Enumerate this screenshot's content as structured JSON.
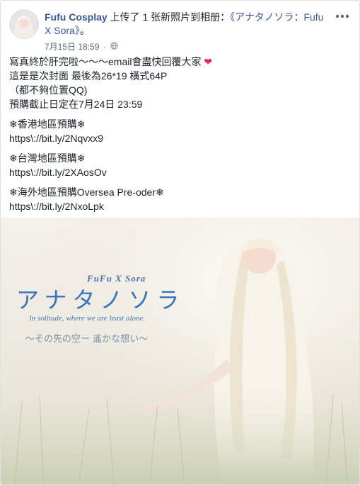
{
  "post": {
    "author": "Fufu Cosplay",
    "action": " 上传了 1 张新照片到相册：",
    "album": "《アナタノソラ：Fufu X Sora》",
    "album_suffix": "。",
    "timestamp": "7月15日 18:59",
    "privacy_icon": "globe-icon",
    "more_icon": "more-options-icon",
    "heart_icon": "red-heart-emoji"
  },
  "body": {
    "lines": [
      "寫真終於肝完啦～～～email會盡快回覆大家",
      "這是是次封面 最後為26*19 橫式64P",
      "（都不夠位置QQ)",
      "預購截止日定在7月24日 23:59"
    ],
    "hk_title": "❄香港地區預購❄",
    "hk_link": "https\\://bit.ly/2Nqvxx9",
    "tw_title": "❄台灣地區預購❄",
    "tw_link": "https\\://bit.ly/2XAosOv",
    "os_title": "❄海外地區預購Oversea Pre-oder❄",
    "os_link": "https\\://bit.ly/2NxoLpk"
  },
  "photo": {
    "brand": "FuFu X Sora",
    "title": "アナタノソラ",
    "tagline": "In solitude, where we are least alone.",
    "subtitle": "～その先の空ー 遙かな想い～"
  },
  "colors": {
    "link": "#385898",
    "text": "#1d2129",
    "meta": "#616770",
    "heart": "#e0245e",
    "overlay_blue": "#3c74b8"
  }
}
